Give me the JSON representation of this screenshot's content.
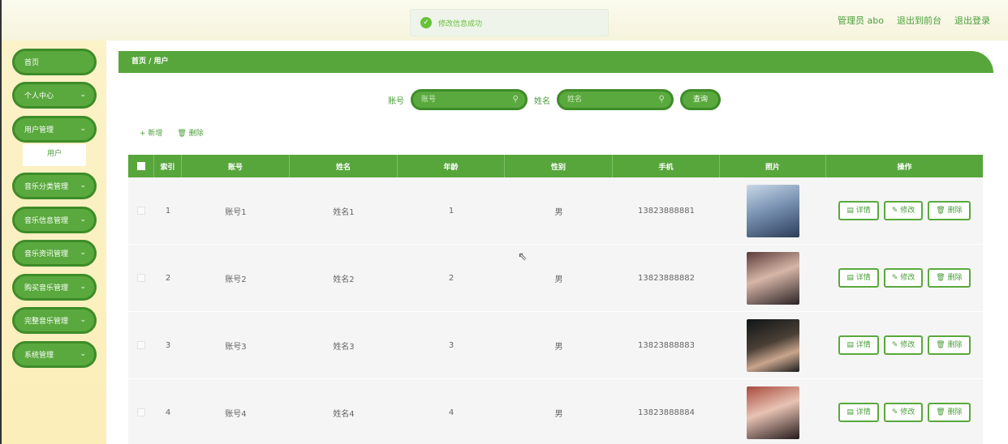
{
  "header": {
    "toast": "修改信息成功",
    "admin": "管理员 abo",
    "to_front": "退出到前台",
    "logout": "退出登录"
  },
  "sidebar": {
    "items": [
      {
        "label": "首页",
        "chevron": false
      },
      {
        "label": "个人中心",
        "chevron": true
      },
      {
        "label": "用户管理",
        "chevron": true
      },
      {
        "label": "音乐分类管理",
        "chevron": true
      },
      {
        "label": "音乐信息管理",
        "chevron": true
      },
      {
        "label": "音乐资讯管理",
        "chevron": true
      },
      {
        "label": "购买音乐管理",
        "chevron": true
      },
      {
        "label": "完整音乐管理",
        "chevron": true
      },
      {
        "label": "系统管理",
        "chevron": true
      }
    ],
    "sub_item": "用户"
  },
  "breadcrumb": "首页 / 用户",
  "search": {
    "account_label": "账号",
    "account_placeholder": "账号",
    "name_label": "姓名",
    "name_placeholder": "姓名",
    "button": "查询"
  },
  "actions": {
    "add": "+ 新增",
    "delete": "删除"
  },
  "table": {
    "headers": [
      "索引",
      "账号",
      "姓名",
      "年龄",
      "性别",
      "手机",
      "照片",
      "操作"
    ],
    "rows": [
      {
        "index": "1",
        "account": "账号1",
        "name": "姓名1",
        "age": "1",
        "gender": "男",
        "phone": "13823888881"
      },
      {
        "index": "2",
        "account": "账号2",
        "name": "姓名2",
        "age": "2",
        "gender": "男",
        "phone": "13823888882"
      },
      {
        "index": "3",
        "account": "账号3",
        "name": "姓名3",
        "age": "3",
        "gender": "男",
        "phone": "13823888883"
      },
      {
        "index": "4",
        "account": "账号4",
        "name": "姓名4",
        "age": "4",
        "gender": "男",
        "phone": "13823888884"
      }
    ],
    "row_buttons": {
      "detail": "详情",
      "edit": "修改",
      "delete": "删除"
    }
  },
  "colors": {
    "accent": "#5aa93e",
    "accent_dark": "#3e8c28",
    "sidebar_bg": "#fbf2c8"
  }
}
